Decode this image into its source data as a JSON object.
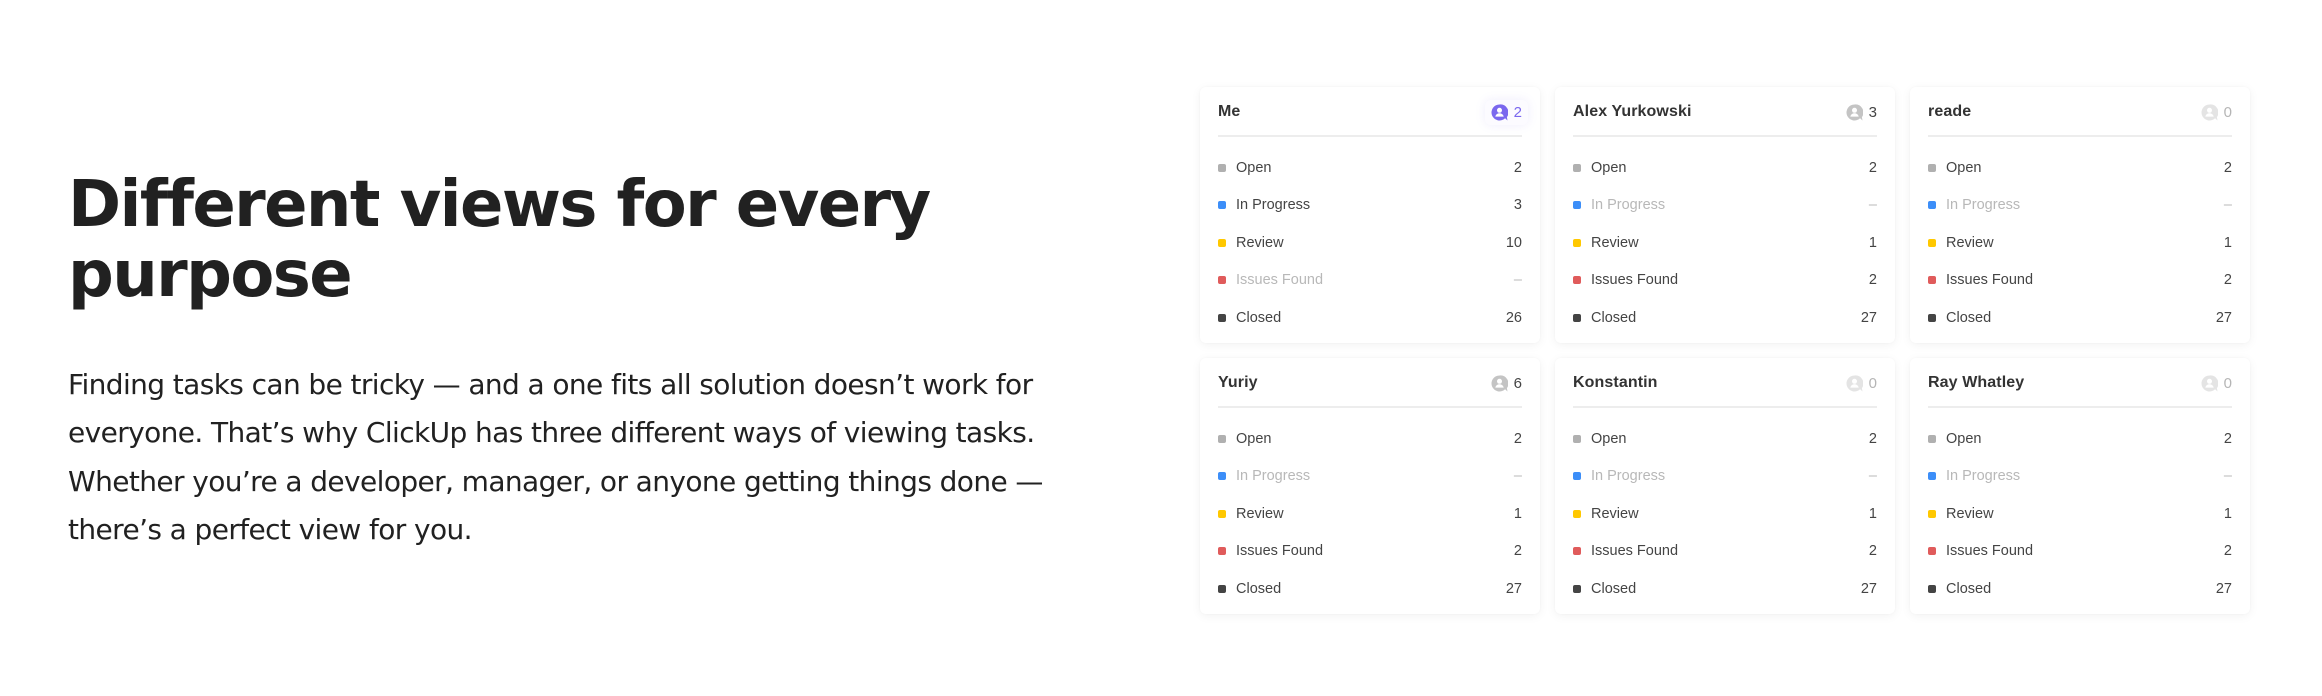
{
  "hero": {
    "title": "Different views for every purpose",
    "body": "Finding tasks can be tricky — and a one fits all solution doesn’t work for everyone. That’s why ClickUp has three different ways of viewing tasks. Whether you’re a developer, manager, or anyone getting things done — there’s a perfect view for you."
  },
  "colors": {
    "open": "#b0b0b0",
    "in_progress": "#3c8ef8",
    "review": "#ffc800",
    "issues_found": "#e05b5b",
    "closed": "#444444",
    "accent": "#7b68ee",
    "avatar_gray": "#c4c4c4"
  },
  "cards": [
    {
      "name": "Me",
      "assignee_icon": "user-bubble-icon",
      "assignee_count": "2",
      "state": "active",
      "statuses": [
        {
          "label": "Open",
          "key": "open",
          "count": "2",
          "muted": false
        },
        {
          "label": "In Progress",
          "key": "in_progress",
          "count": "3",
          "muted": false
        },
        {
          "label": "Review",
          "key": "review",
          "count": "10",
          "muted": false
        },
        {
          "label": "Issues Found",
          "key": "issues_found",
          "count": "–",
          "muted": true
        },
        {
          "label": "Closed",
          "key": "closed",
          "count": "26",
          "muted": false
        }
      ]
    },
    {
      "name": "Alex Yurkowski",
      "assignee_icon": "user-bubble-icon",
      "assignee_count": "3",
      "state": "normal",
      "statuses": [
        {
          "label": "Open",
          "key": "open",
          "count": "2",
          "muted": false
        },
        {
          "label": "In Progress",
          "key": "in_progress",
          "count": "–",
          "muted": true
        },
        {
          "label": "Review",
          "key": "review",
          "count": "1",
          "muted": false
        },
        {
          "label": "Issues Found",
          "key": "issues_found",
          "count": "2",
          "muted": false
        },
        {
          "label": "Closed",
          "key": "closed",
          "count": "27",
          "muted": false
        }
      ]
    },
    {
      "name": "reade",
      "assignee_icon": "user-bubble-icon",
      "assignee_count": "0",
      "state": "empty",
      "statuses": [
        {
          "label": "Open",
          "key": "open",
          "count": "2",
          "muted": false
        },
        {
          "label": "In Progress",
          "key": "in_progress",
          "count": "–",
          "muted": true
        },
        {
          "label": "Review",
          "key": "review",
          "count": "1",
          "muted": false
        },
        {
          "label": "Issues Found",
          "key": "issues_found",
          "count": "2",
          "muted": false
        },
        {
          "label": "Closed",
          "key": "closed",
          "count": "27",
          "muted": false
        }
      ]
    },
    {
      "name": "Yuriy",
      "assignee_icon": "user-bubble-icon",
      "assignee_count": "6",
      "state": "normal",
      "statuses": [
        {
          "label": "Open",
          "key": "open",
          "count": "2",
          "muted": false
        },
        {
          "label": "In Progress",
          "key": "in_progress",
          "count": "–",
          "muted": true
        },
        {
          "label": "Review",
          "key": "review",
          "count": "1",
          "muted": false
        },
        {
          "label": "Issues Found",
          "key": "issues_found",
          "count": "2",
          "muted": false
        },
        {
          "label": "Closed",
          "key": "closed",
          "count": "27",
          "muted": false
        }
      ]
    },
    {
      "name": "Konstantin",
      "assignee_icon": "user-bubble-icon",
      "assignee_count": "0",
      "state": "empty",
      "statuses": [
        {
          "label": "Open",
          "key": "open",
          "count": "2",
          "muted": false
        },
        {
          "label": "In Progress",
          "key": "in_progress",
          "count": "–",
          "muted": true
        },
        {
          "label": "Review",
          "key": "review",
          "count": "1",
          "muted": false
        },
        {
          "label": "Issues Found",
          "key": "issues_found",
          "count": "2",
          "muted": false
        },
        {
          "label": "Closed",
          "key": "closed",
          "count": "27",
          "muted": false
        }
      ]
    },
    {
      "name": "Ray Whatley",
      "assignee_icon": "user-bubble-icon",
      "assignee_count": "0",
      "state": "empty",
      "statuses": [
        {
          "label": "Open",
          "key": "open",
          "count": "2",
          "muted": false
        },
        {
          "label": "In Progress",
          "key": "in_progress",
          "count": "–",
          "muted": true
        },
        {
          "label": "Review",
          "key": "review",
          "count": "1",
          "muted": false
        },
        {
          "label": "Issues Found",
          "key": "issues_found",
          "count": "2",
          "muted": false
        },
        {
          "label": "Closed",
          "key": "closed",
          "count": "27",
          "muted": false
        }
      ]
    }
  ]
}
